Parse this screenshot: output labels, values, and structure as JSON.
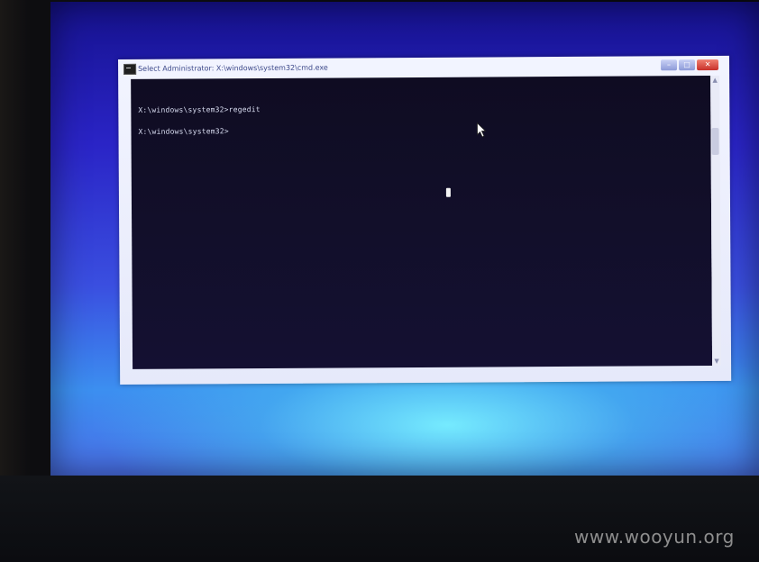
{
  "window": {
    "title": "Select Administrator: X:\\windows\\system32\\cmd.exe",
    "controls": {
      "minimize": "–",
      "maximize": "□",
      "close": "✕"
    }
  },
  "console": {
    "lines": [
      "X:\\windows\\system32>regedit",
      "X:\\windows\\system32>"
    ]
  },
  "scrollbar": {
    "up": "▲",
    "down": "▼"
  },
  "icons": [
    "cmd-icon",
    "mouse-pointer-icon"
  ],
  "watermark": "www.wooyun.org",
  "colors": {
    "console_bg": "#0f0c22",
    "desktop_top": "#16128f",
    "desktop_glow": "#78f0ff",
    "close_button": "#c8302a"
  }
}
